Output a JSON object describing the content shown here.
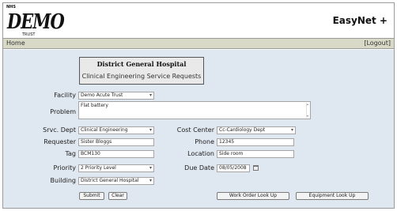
{
  "header": {
    "logo_small": "NHS",
    "logo_big": "DEMO",
    "logo_sub": "TRUST",
    "app_title": "EasyNet +"
  },
  "nav": {
    "home": "Home",
    "logout": "[Logout]"
  },
  "form_title": {
    "organisation": "District General Hospital",
    "subtitle": "Clinical Engineering Service Requests"
  },
  "labels": {
    "facility": "Facility",
    "problem": "Problem",
    "srvc_dept": "Srvc. Dept",
    "requester": "Requester",
    "tag": "Tag",
    "priority": "Priority",
    "building": "Building",
    "cost_center": "Cost Center",
    "phone": "Phone",
    "location": "Location",
    "due_date": "Due Date"
  },
  "values": {
    "facility": "Demo Acute Trust",
    "problem": "Flat battery",
    "srvc_dept": "Clinical Engineering",
    "requester": "Sister Bloggs",
    "tag": "BCM130",
    "priority": "2 Priority Level",
    "building": "District General Hospital",
    "cost_center": "Cc-Cardiology Dept",
    "phone": "12345",
    "location": "Side room",
    "due_date": "08/05/2008"
  },
  "buttons": {
    "submit": "Submit",
    "clear": "Clear",
    "work_order_lookup": "Work Order Look Up",
    "equipment_lookup": "Equipment Look Up"
  },
  "icons": {
    "select_arrow": "chevron-down-icon",
    "calendar": "calendar-icon"
  }
}
